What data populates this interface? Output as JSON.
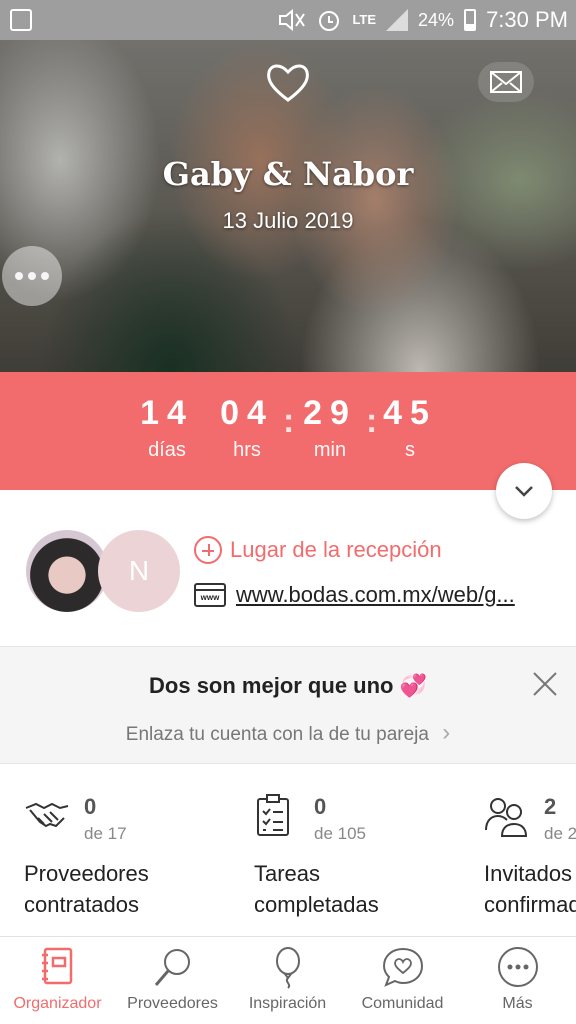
{
  "status_bar": {
    "battery": "24%",
    "time": "7:30 PM",
    "network": "LTE"
  },
  "hero": {
    "couple_name": "Gaby & Nabor",
    "wedding_date": "13 Julio 2019"
  },
  "countdown": {
    "days": "14",
    "days_label": "días",
    "hours": "04",
    "hours_label": "hrs",
    "minutes": "29",
    "minutes_label": "min",
    "seconds": "45",
    "seconds_label": "s",
    "separator": ":"
  },
  "info": {
    "partner_initial": "N",
    "venue_label": "Lugar de la recepción",
    "website_url": "www.bodas.com.mx/web/g..."
  },
  "partner_banner": {
    "title": "Dos son mejor que uno 💞",
    "link_label": "Enlaza tu cuenta con la de tu pareja",
    "link_arrow": "›"
  },
  "stats": [
    {
      "count": "0",
      "total": "de 17",
      "label_line1": "Proveedores",
      "label_line2": "contratados",
      "icon": "handshake-icon"
    },
    {
      "count": "0",
      "total": "de 105",
      "label_line1": "Tareas",
      "label_line2": "completadas",
      "icon": "checklist-icon"
    },
    {
      "count": "2",
      "total": "de 2",
      "label_line1": "Invitados",
      "label_line2": "confirmados",
      "icon": "guests-icon"
    }
  ],
  "bottom_nav": [
    {
      "label": "Organizador",
      "icon": "notebook-icon",
      "active": true
    },
    {
      "label": "Proveedores",
      "icon": "search-icon",
      "active": false
    },
    {
      "label": "Inspiración",
      "icon": "balloon-icon",
      "active": false
    },
    {
      "label": "Comunidad",
      "icon": "chat-heart-icon",
      "active": false
    },
    {
      "label": "Más",
      "icon": "more-icon",
      "active": false
    }
  ],
  "colors": {
    "accent": "#f26c6d",
    "status_bar": "#9e9e9e",
    "partner_avatar": "#ecd4d6"
  }
}
